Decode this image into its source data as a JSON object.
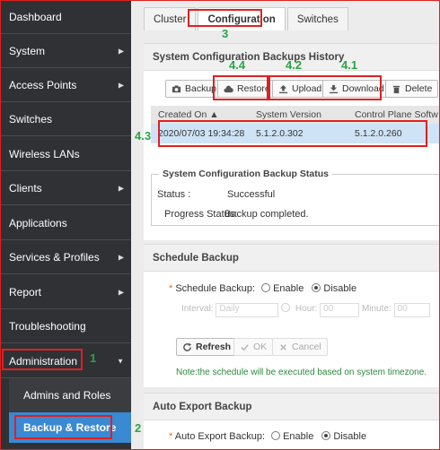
{
  "sidebar": {
    "items": [
      {
        "label": "Dashboard",
        "arrow": ""
      },
      {
        "label": "System",
        "arrow": "▶"
      },
      {
        "label": "Access Points",
        "arrow": "▶"
      },
      {
        "label": "Switches",
        "arrow": ""
      },
      {
        "label": "Wireless LANs",
        "arrow": ""
      },
      {
        "label": "Clients",
        "arrow": "▶"
      },
      {
        "label": "Applications",
        "arrow": ""
      },
      {
        "label": "Services & Profiles",
        "arrow": "▶"
      },
      {
        "label": "Report",
        "arrow": "▶"
      },
      {
        "label": "Troubleshooting",
        "arrow": ""
      },
      {
        "label": "Administration",
        "arrow": "▼"
      }
    ],
    "subitems": [
      {
        "label": "Admins and Roles"
      },
      {
        "label": "Backup & Restore"
      }
    ]
  },
  "tabs": [
    "Cluster",
    "Configuration",
    "Switches"
  ],
  "backups": {
    "title": "System Configuration Backups History",
    "toolbar": {
      "backup": "Backup",
      "restore": "Restore",
      "upload": "Upload",
      "download": "Download",
      "delete": "Delete"
    },
    "columns": [
      "Created On ▲",
      "System Version",
      "Control Plane Softw"
    ],
    "rows": [
      [
        "2020/07/03 19:34:28",
        "5.1.2.0.302",
        "5.1.2.0.260"
      ]
    ],
    "status": {
      "legend": "System Configuration Backup Status",
      "status_label": "Status :",
      "status_value": "Successful",
      "progress_label": "Progress Status:",
      "progress_value": "Backup completed."
    }
  },
  "schedule": {
    "title": "Schedule Backup",
    "label": "Schedule Backup:",
    "enable": "Enable",
    "disable": "Disable",
    "interval_label": "Interval:",
    "interval_value": "Daily",
    "hour_label": "Hour:",
    "hour_value": "00",
    "minute_label": "Minute:",
    "minute_value": "00",
    "refresh": "Refresh",
    "ok": "OK",
    "cancel": "Cancel",
    "note": "Note:the schedule will be executed based on system timezone."
  },
  "auto_export": {
    "title": "Auto Export Backup",
    "label": "Auto Export Backup:",
    "enable": "Enable",
    "disable": "Disable"
  },
  "annotations": [
    "1",
    "2",
    "3",
    "4.1",
    "4.2",
    "4.3",
    "4.4"
  ],
  "colors": {
    "sidebar": "#2f3135",
    "active": "#3a89d3",
    "highlight": "#e02020",
    "step": "#27a644",
    "note": "#2a8a3a"
  }
}
